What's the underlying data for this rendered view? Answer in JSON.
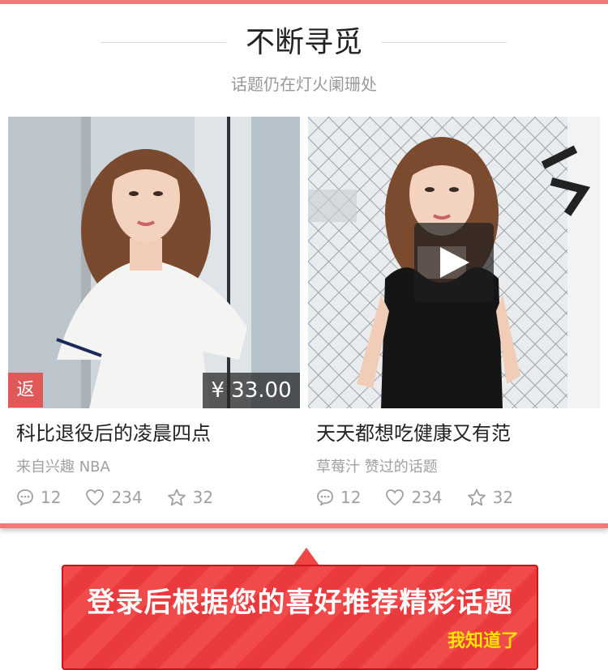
{
  "header": {
    "title": "不断寻觅",
    "subtitle": "话题仍在灯火阑珊处"
  },
  "cards": [
    {
      "title": "科比退役后的凌晨四点",
      "source": "来自兴趣 NBA",
      "badge": "返",
      "price": "¥ 33.00",
      "comments": "12",
      "likes": "234",
      "stars": "32",
      "has_video": false
    },
    {
      "title": "天天都想吃健康又有范",
      "source": "草莓汁 赞过的话题",
      "comments": "12",
      "likes": "234",
      "stars": "32",
      "has_video": true
    }
  ],
  "tip": {
    "message": "登录后根据您的喜好推荐精彩话题",
    "ok_label": "我知道了"
  },
  "colors": {
    "accent": "#f07a7a",
    "tip_bg": "#f04a4a",
    "tip_ok": "#ffe300",
    "badge": "#e05858"
  },
  "icons": [
    "comment-icon",
    "heart-icon",
    "star-icon",
    "play-icon"
  ]
}
